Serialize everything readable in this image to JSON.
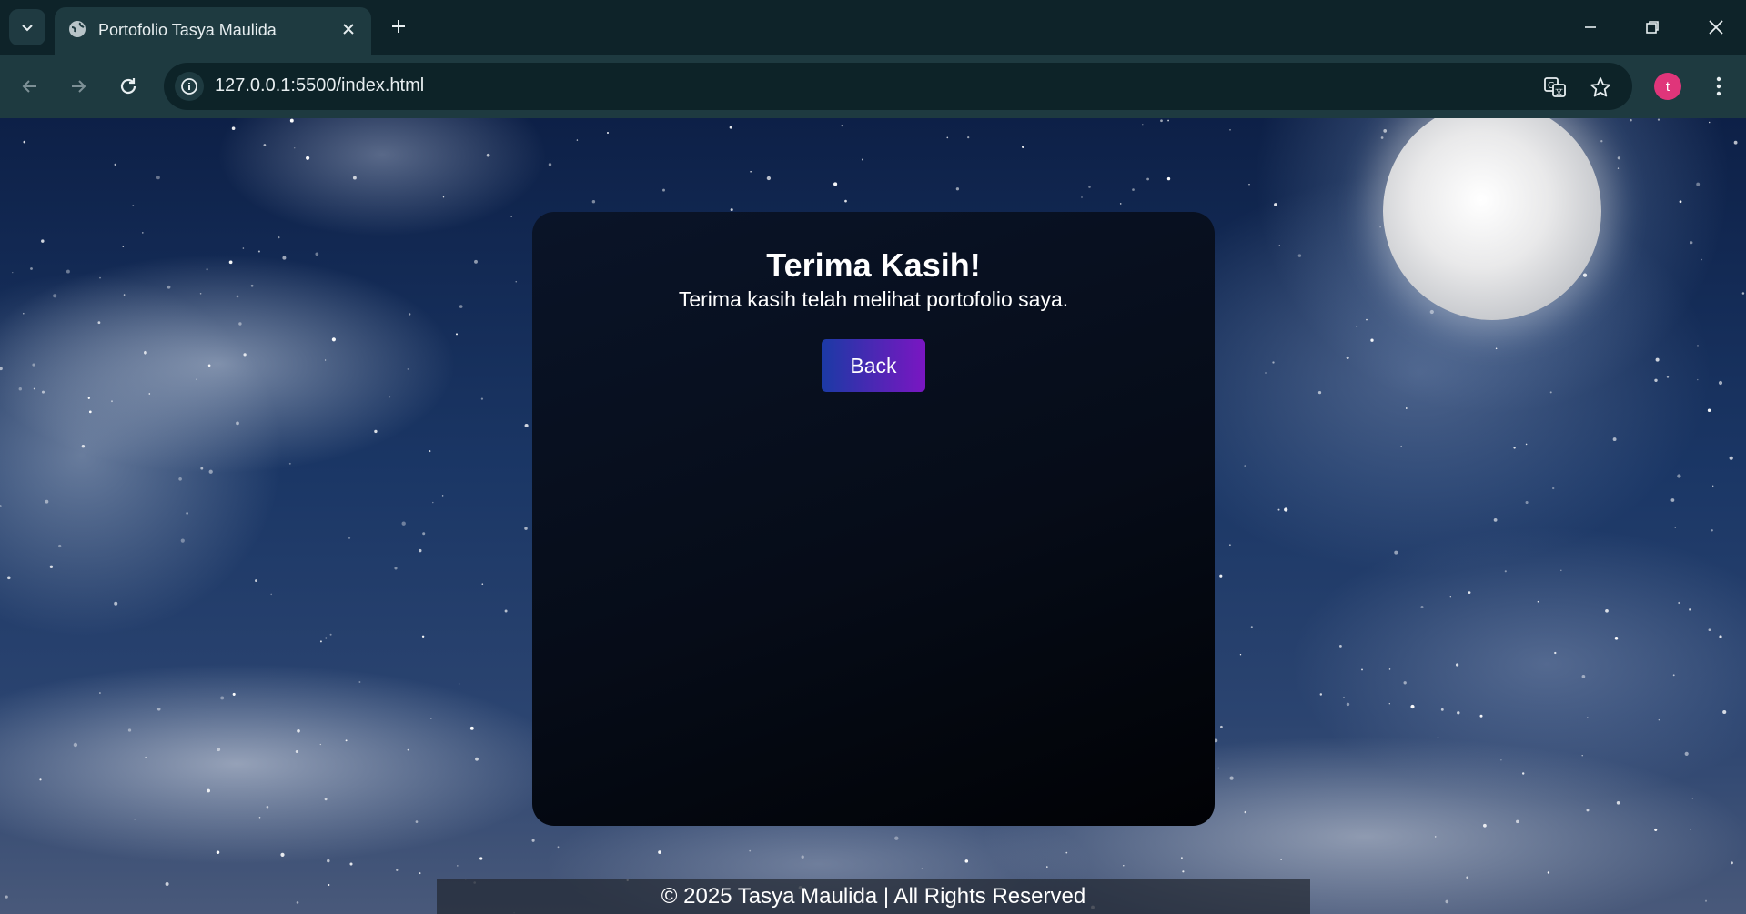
{
  "browser": {
    "tab_title": "Portofolio Tasya Maulida",
    "url": "127.0.0.1:5500/index.html",
    "profile_initial": "t",
    "icons": {
      "tab_search": "chevron-down-icon",
      "favicon": "globe-icon",
      "tab_close": "close-icon",
      "new_tab": "plus-icon",
      "minimize": "minimize-icon",
      "restore": "restore-icon",
      "close_window": "close-icon",
      "back": "arrow-left-icon",
      "forward": "arrow-right-icon",
      "reload": "reload-icon",
      "site_info": "info-icon",
      "translate": "translate-icon",
      "bookmark": "star-icon",
      "menu": "more-vertical-icon"
    },
    "colors": {
      "avatar": "#e0357a"
    }
  },
  "page": {
    "title": "Terima Kasih!",
    "message": "Terima kasih telah melihat portofolio saya.",
    "back_label": "Back",
    "footer": "© 2025 Tasya Maulida | All Rights Reserved",
    "colors": {
      "button_start": "#1b3aa5",
      "button_end": "#7a16c2"
    }
  }
}
